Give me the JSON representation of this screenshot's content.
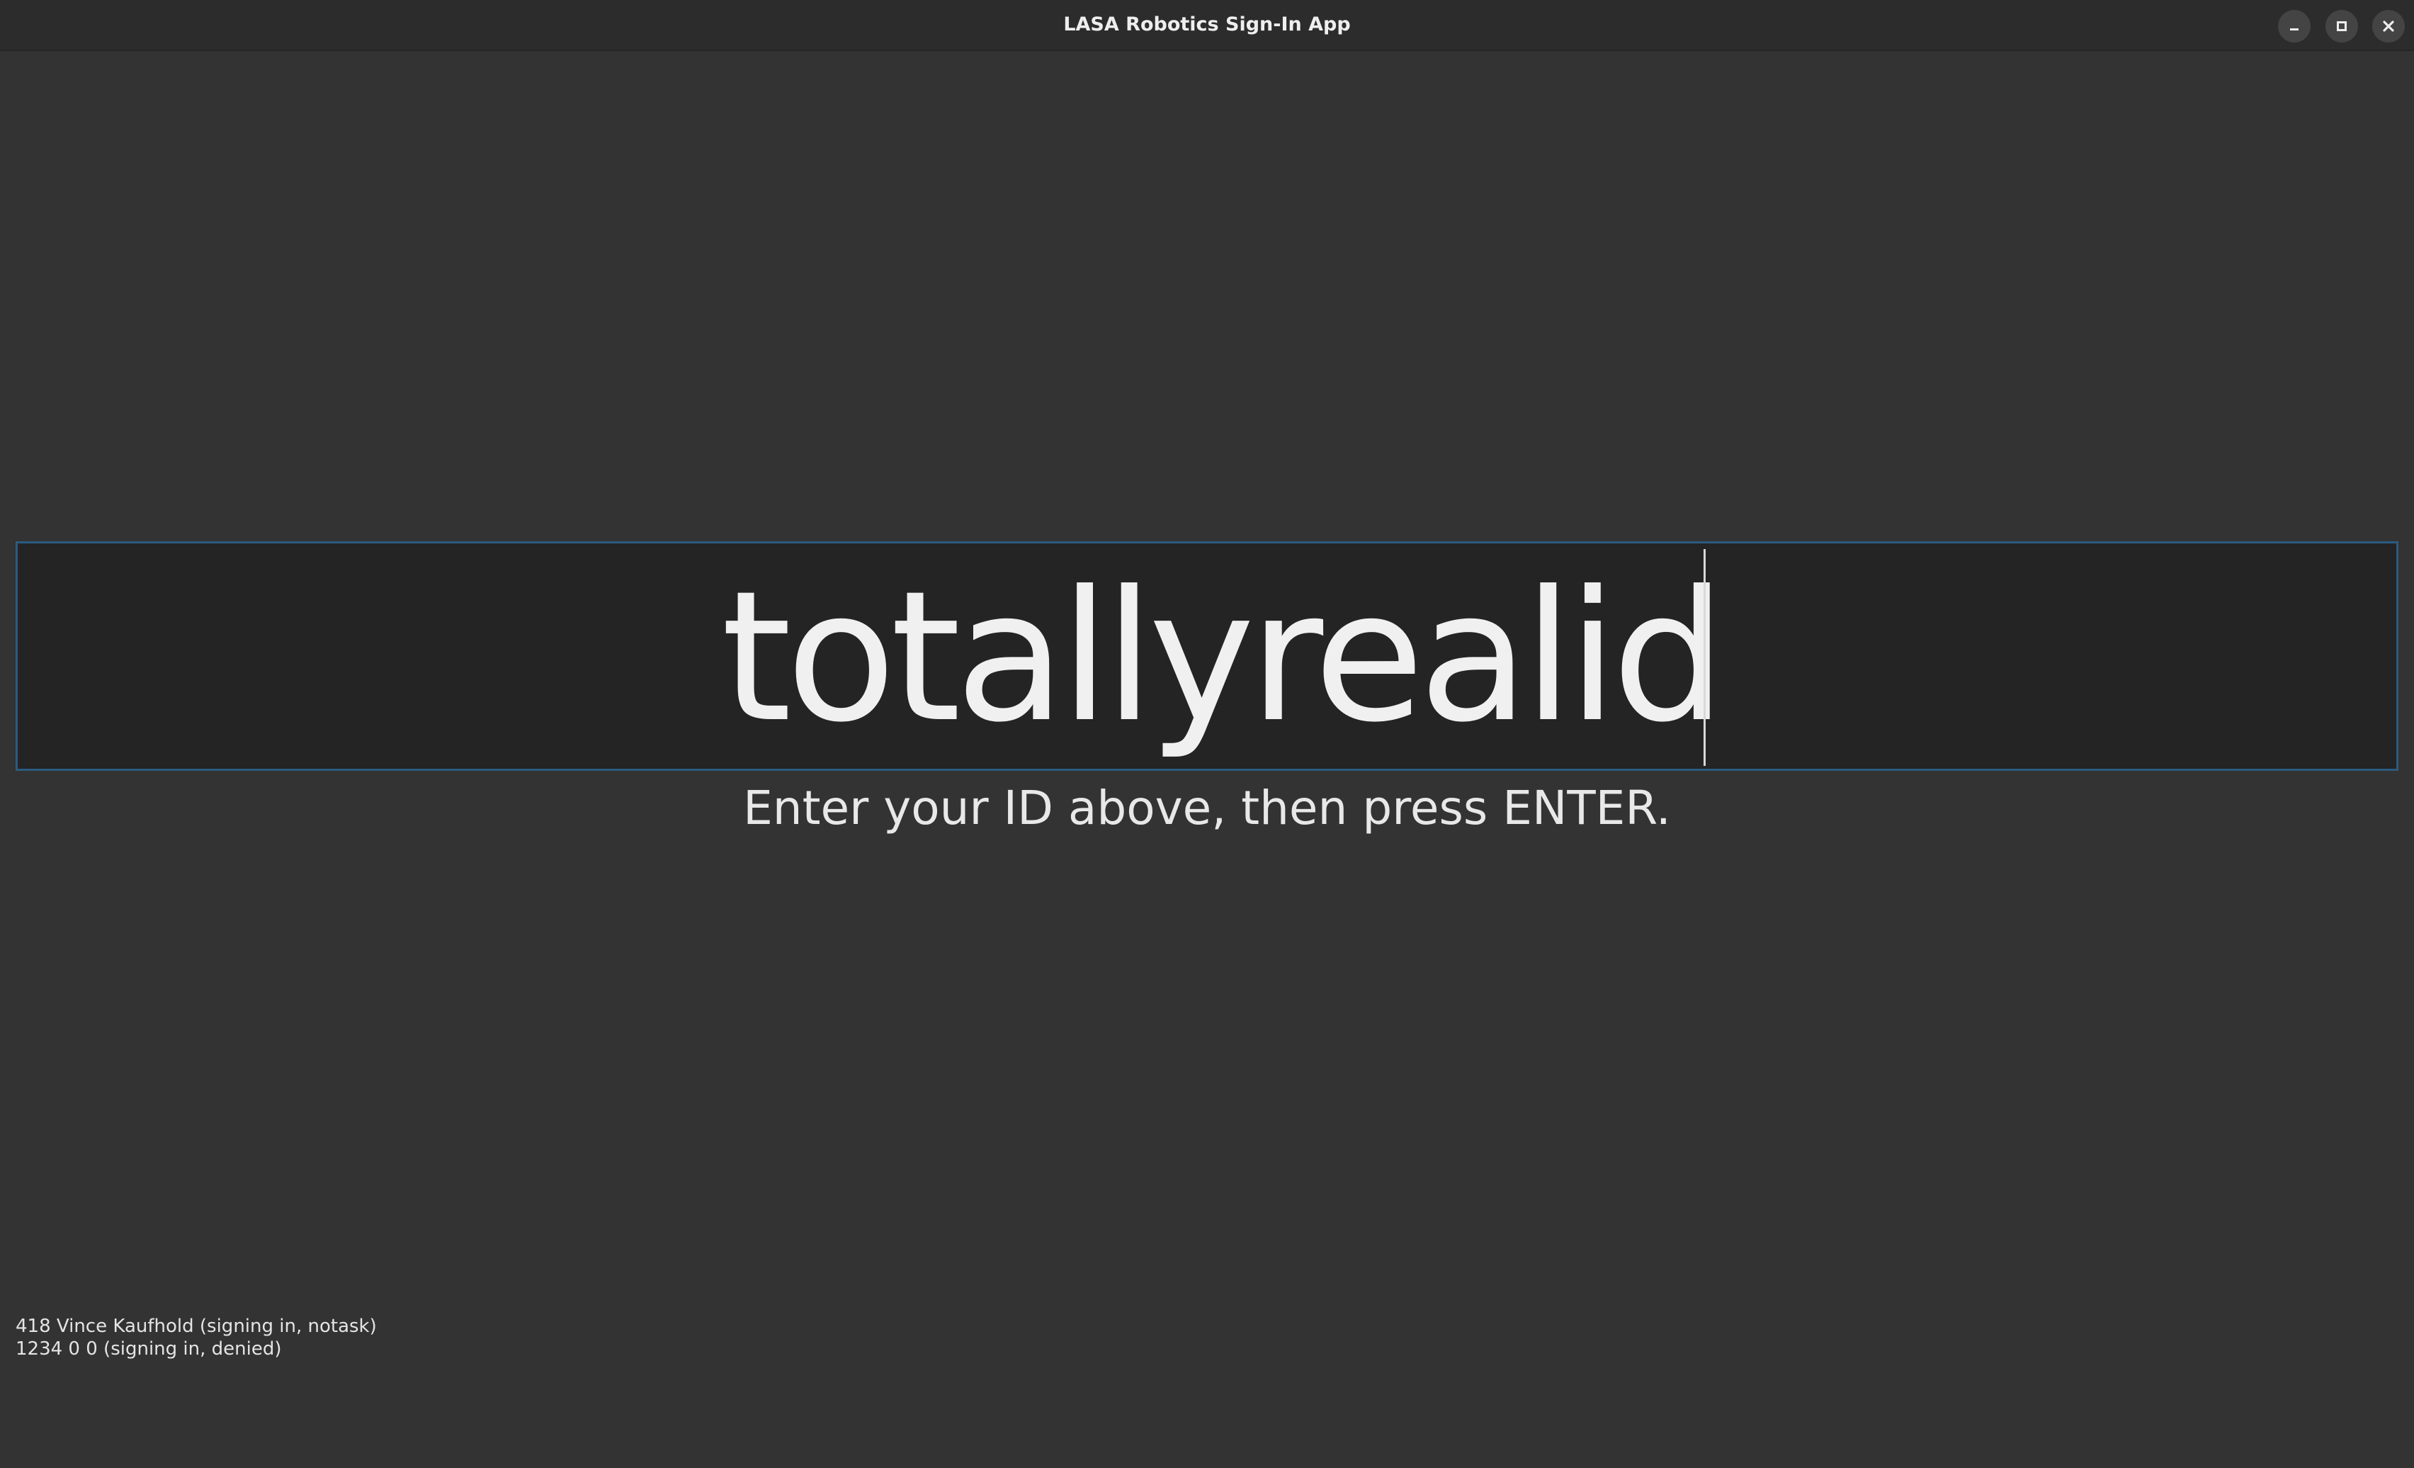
{
  "window": {
    "title": "LASA Robotics Sign-In App",
    "controls": {
      "minimize_icon": "minimize-icon",
      "maximize_icon": "maximize-icon",
      "close_icon": "close-icon"
    }
  },
  "signin": {
    "id_value": "totallyrealid",
    "hint": "Enter your ID above, then press ENTER."
  },
  "log": {
    "lines": [
      "418 Vince Kaufhold (signing in, notask)",
      "1234 0 0 (signing in, denied)"
    ]
  },
  "colors": {
    "background": "#333333",
    "field_background": "#242424",
    "field_border": "#2b5b7f",
    "text": "#f0f0f0"
  }
}
